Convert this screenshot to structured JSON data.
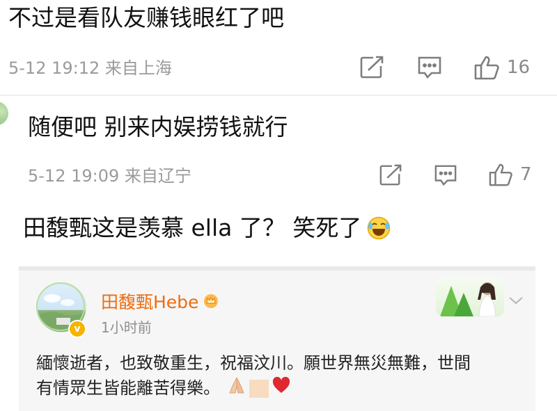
{
  "comments": [
    {
      "text": "不过是看队友赚钱眼红了吧",
      "meta": "5-12 19:12 来自上海",
      "likes": "16"
    },
    {
      "text": "随便吧 别来内娱捞钱就行",
      "meta": "5-12 19:09 来自辽宁",
      "likes": "7"
    },
    {
      "text": "田馥甄这是羡慕 ella 了？ 笑死了"
    }
  ],
  "quoted_post": {
    "author": "田馥甄Hebe",
    "time": "1小时前",
    "line1": "緬懷逝者，也致敬重生，祝福汶川。願世界無災無難，世間",
    "line2": "有情眾生皆能離苦得樂。"
  },
  "icons": {
    "share": "share-icon",
    "comment": "comment-icon",
    "like": "thumbs-up-icon"
  },
  "colors": {
    "author": "#ef6c10",
    "meta": "#9a9a9a"
  }
}
